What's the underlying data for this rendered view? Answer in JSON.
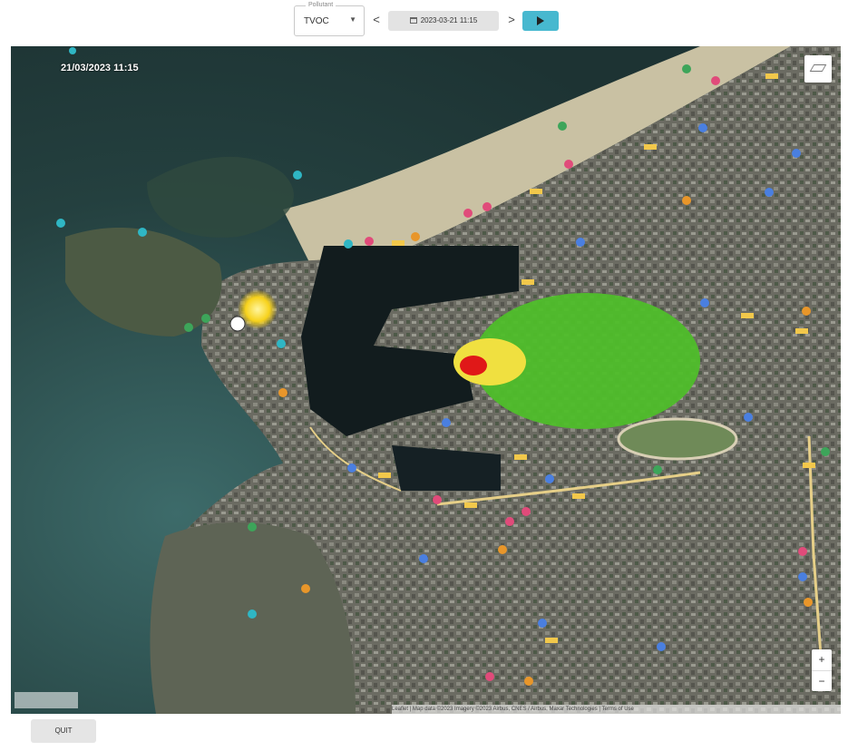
{
  "toolbar": {
    "pollutant_legend": "Pollutant",
    "pollutant_value": "TVOC",
    "prev_label": "<",
    "next_label": ">",
    "datetime_value": "2023-03-21 11:15"
  },
  "map": {
    "overlay_timestamp": "21/03/2023 11:15",
    "attribution": "Leaflet | Map data ©2023 Imagery ©2023 Airbus, CNES / Airbus, Maxar Technologies | Terms of Use"
  },
  "footer": {
    "quit_label": "QUIT"
  },
  "colors": {
    "play_button": "#47b8cf",
    "plume_high": "#e01818",
    "plume_mid": "#f0e040",
    "plume_low": "#4fbe2a",
    "source_marker": "#f7d21c"
  }
}
